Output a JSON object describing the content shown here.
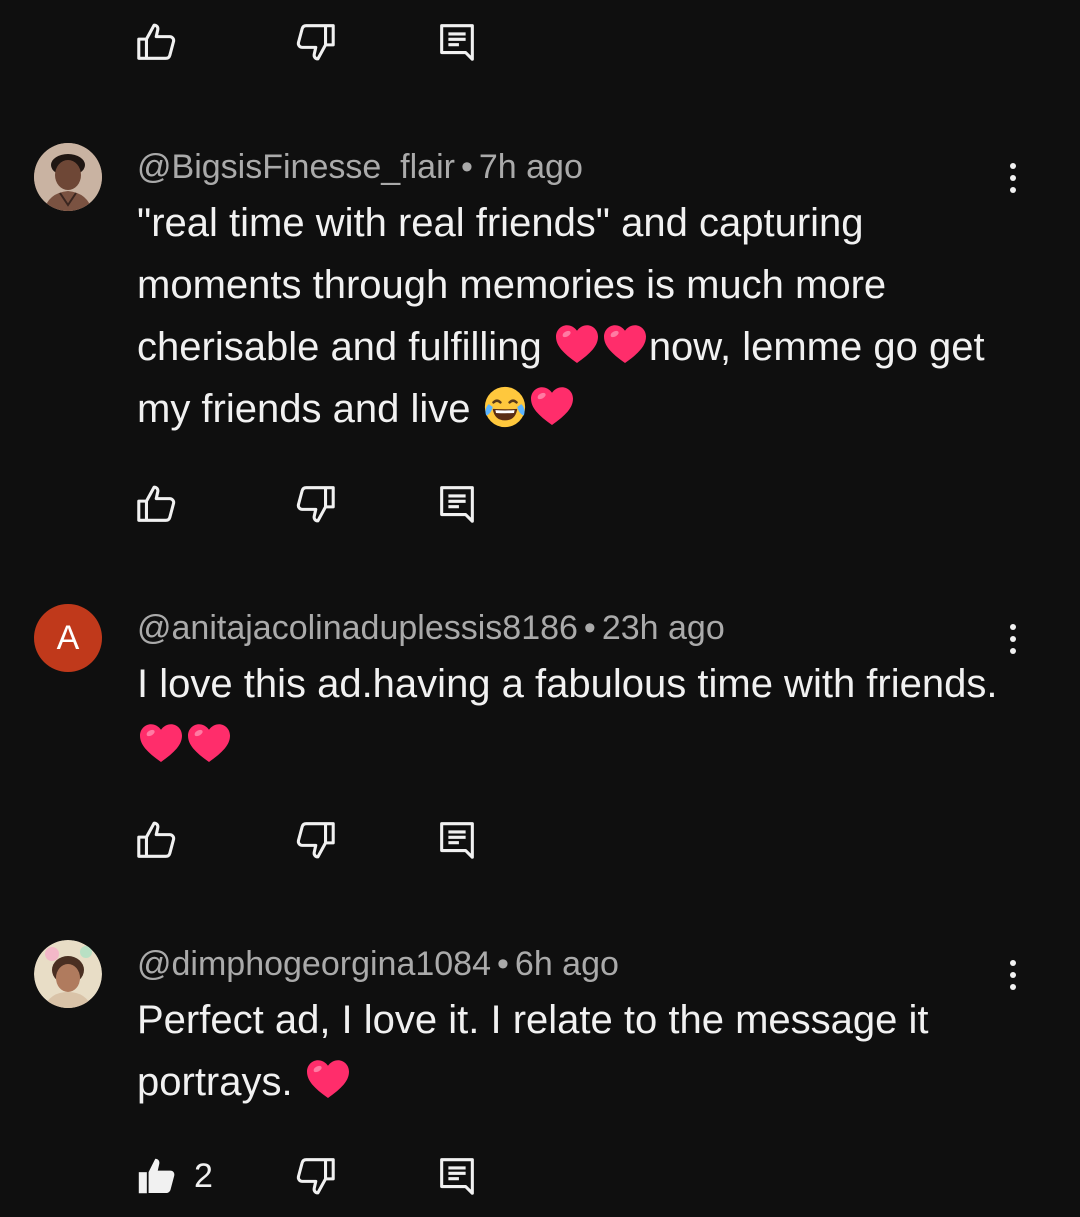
{
  "comments": [
    {
      "author": "@BigsisFinesse_flair",
      "time": "7h ago",
      "text_1": "\"real time with real friends\"  and capturing moments through memories is much more cherisable and fulfilling ",
      "text_2": "now, lemme go get my friends and live ",
      "likes": ""
    },
    {
      "author": "@anitajacolinaduplessis8186",
      "time": "23h ago",
      "avatar_letter": "A",
      "avatar_color": "#c0391b",
      "text_1": "I love this ad.having a fabulous time with friends.",
      "likes": ""
    },
    {
      "author": "@dimphogeorgina1084",
      "time": "6h ago",
      "text_1": "Perfect ad, I love it. I relate to the message it portrays. ",
      "likes": "2"
    }
  ],
  "separator": "•",
  "icons": {
    "like": "thumbs-up-icon",
    "like_filled": "thumbs-up-filled-icon",
    "dislike": "thumbs-down-icon",
    "reply": "reply-icon",
    "more": "more-vert-icon",
    "heart": "red-heart-emoji",
    "laugh": "tears-of-joy-emoji"
  },
  "colors": {
    "background": "#0f0f0f",
    "text": "#f1f1f1",
    "meta": "#aaaaaa",
    "heart": "#ff2d6b"
  }
}
